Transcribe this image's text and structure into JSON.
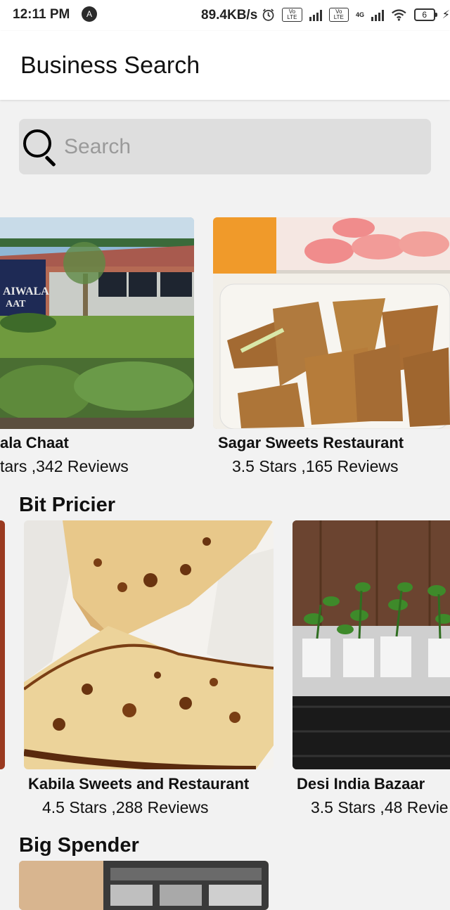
{
  "status_bar": {
    "time": "12:11 PM",
    "nav_badge": "A",
    "net_speed": "89.4KB/s",
    "volte_1": "Vo LTE",
    "volte_2": "Vo LTE",
    "net_type": "4G",
    "battery_level": "6"
  },
  "app_bar": {
    "title": "Business Search"
  },
  "search": {
    "placeholder": "Search",
    "value": ""
  },
  "sections": [
    {
      "title": "",
      "items": [
        {
          "name": "ala Chaat",
          "rating": "tars ,342 Reviews"
        },
        {
          "name": "Sagar Sweets Restaurant",
          "rating": "3.5 Stars ,165 Reviews"
        }
      ]
    },
    {
      "title": "Bit Pricier",
      "items": [
        {
          "name": "Kabila Sweets and Restaurant",
          "rating": "4.5 Stars ,288 Reviews"
        },
        {
          "name": "Desi India Bazaar",
          "rating": "3.5 Stars ,48 Revie"
        }
      ]
    },
    {
      "title": "Big Spender",
      "items": []
    }
  ],
  "colors": {
    "background": "#f2f2f2",
    "search_bg": "#dedede",
    "app_bar_bg": "#ffffff"
  }
}
